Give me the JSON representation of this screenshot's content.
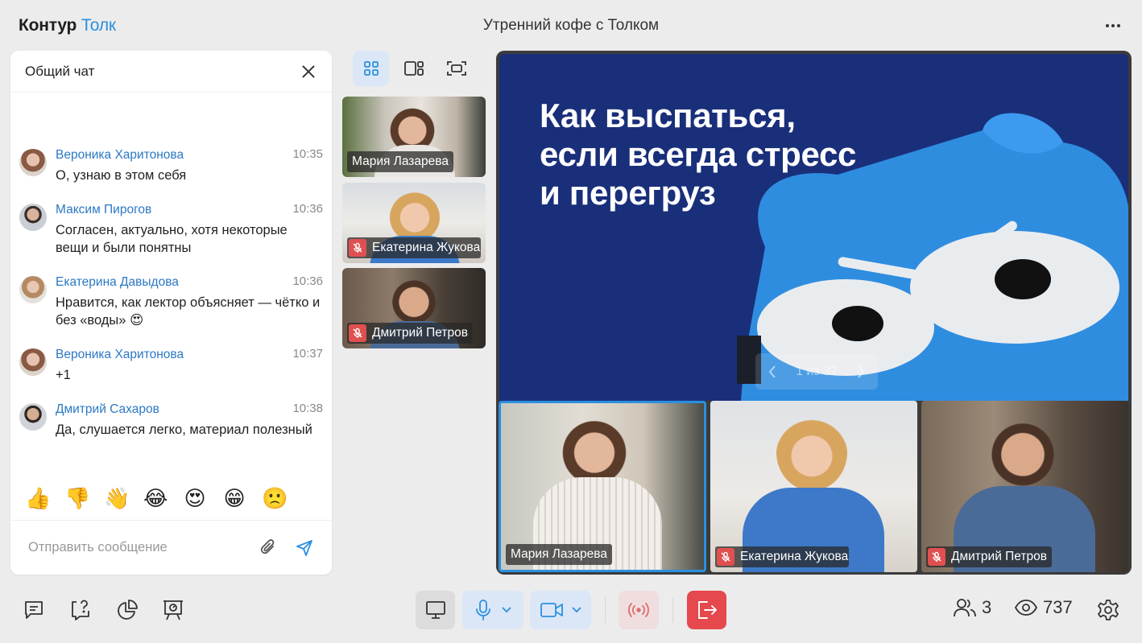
{
  "app": {
    "brand": "Контур",
    "product": "Толк",
    "meeting_title": "Утренний кофе с Толком"
  },
  "chat": {
    "title": "Общий чат",
    "messages": [
      {
        "author": "Вероника Харитонова",
        "time": "10:35",
        "text": "О, узнаю в этом себя"
      },
      {
        "author": "Максим Пирогов",
        "time": "10:36",
        "text": "Согласен, актуально, хотя некоторые вещи и были понятны"
      },
      {
        "author": "Екатерина Давыдова",
        "time": "10:36",
        "text": "Нравится, как лектор объясняет — чётко и без «воды» 😍"
      },
      {
        "author": "Вероника Харитонова",
        "time": "10:37",
        "text": "+1"
      },
      {
        "author": "Дмитрий Сахаров",
        "time": "10:38",
        "text": "Да, слушается легко, материал полезный"
      }
    ],
    "reactions": [
      "👍",
      "👎",
      "👋",
      "😂",
      "😍",
      "😁",
      "🙁"
    ],
    "input_placeholder": "Отправить сообщение"
  },
  "thumbnails": [
    {
      "name": "Мария Лазарева",
      "muted": false
    },
    {
      "name": "Екатерина Жукова",
      "muted": true
    },
    {
      "name": "Дмитрий Петров",
      "muted": true
    }
  ],
  "slide": {
    "title_lines": [
      "Как выспаться,",
      "если всегда стресс",
      "и перегруз"
    ],
    "pager": "1 из 37"
  },
  "tiles": [
    {
      "name": "Мария Лазарева",
      "muted": false,
      "active": true
    },
    {
      "name": "Екатерина Жукова",
      "muted": true,
      "active": false
    },
    {
      "name": "Дмитрий Петров",
      "muted": true,
      "active": false
    }
  ],
  "stats": {
    "participants": "3",
    "viewers": "737"
  },
  "colors": {
    "accent": "#2b8fe0",
    "slide_bg": "#1a2f7a",
    "leave": "#e5484d",
    "mute": "#e05050"
  }
}
